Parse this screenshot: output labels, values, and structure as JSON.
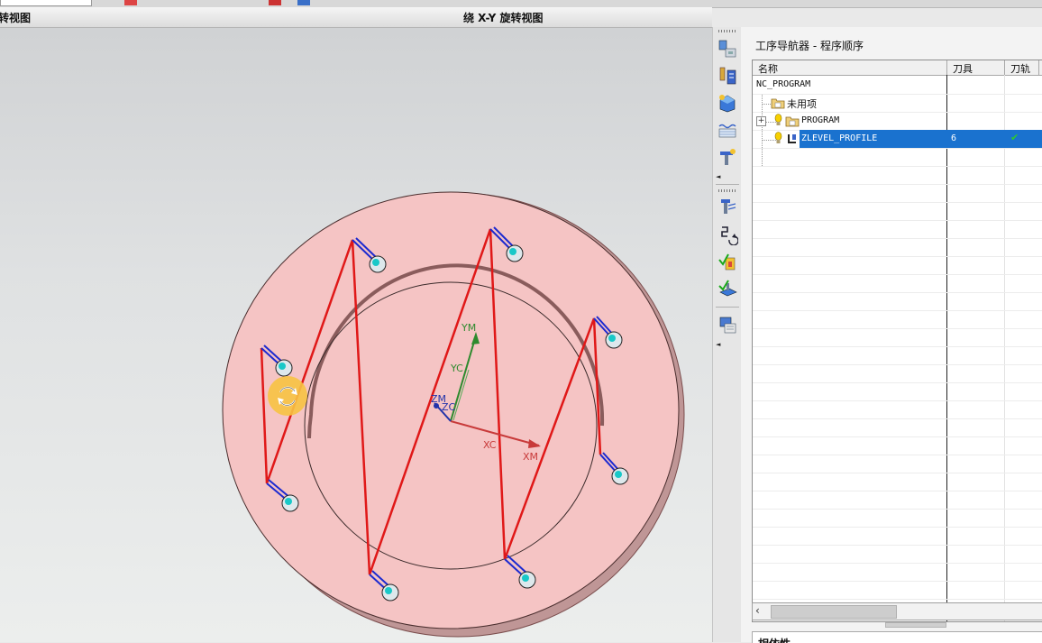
{
  "titlebar": {
    "left": "旋转视图",
    "center": "绕 X-Y 旋转视图"
  },
  "axes": {
    "ym": "YM",
    "yc": "YC",
    "zm": "ZM",
    "zc": "ZC",
    "xc": "XC",
    "xm": "XM"
  },
  "colors": {
    "part_fill": "#f5c4c4",
    "toolpath": "#e01818",
    "approach": "#1c2ad0",
    "selection": "#1a72cf",
    "csys_x": "#c83a3a",
    "csys_y": "#2e8a2e",
    "csys_z": "#2233aa",
    "rotate_cursor": "#f7c342"
  },
  "resource_bar": {
    "icons": [
      "machine-tool-icon",
      "tool-navigator-icon",
      "part-navigator-icon",
      "roles-icon",
      "history-icon",
      "operation-icon",
      "reorder-icon",
      "verify-icon",
      "simulate-icon",
      "shop-doc-icon"
    ]
  },
  "navigator": {
    "title": "工序导航器 - 程序顺序",
    "columns": [
      "名称",
      "刀具",
      "刀轨"
    ],
    "rows": [
      {
        "name": "NC_PROGRAM",
        "tool": "",
        "path": ""
      },
      {
        "name": "未用项",
        "tool": "",
        "path": ""
      },
      {
        "name": "PROGRAM",
        "tool": "",
        "path": "",
        "expander": "+"
      },
      {
        "name": "ZLEVEL_PROFILE",
        "tool": "6",
        "path": "✔",
        "selected": true
      }
    ]
  },
  "bottom_panel": {
    "label": "相依性"
  }
}
